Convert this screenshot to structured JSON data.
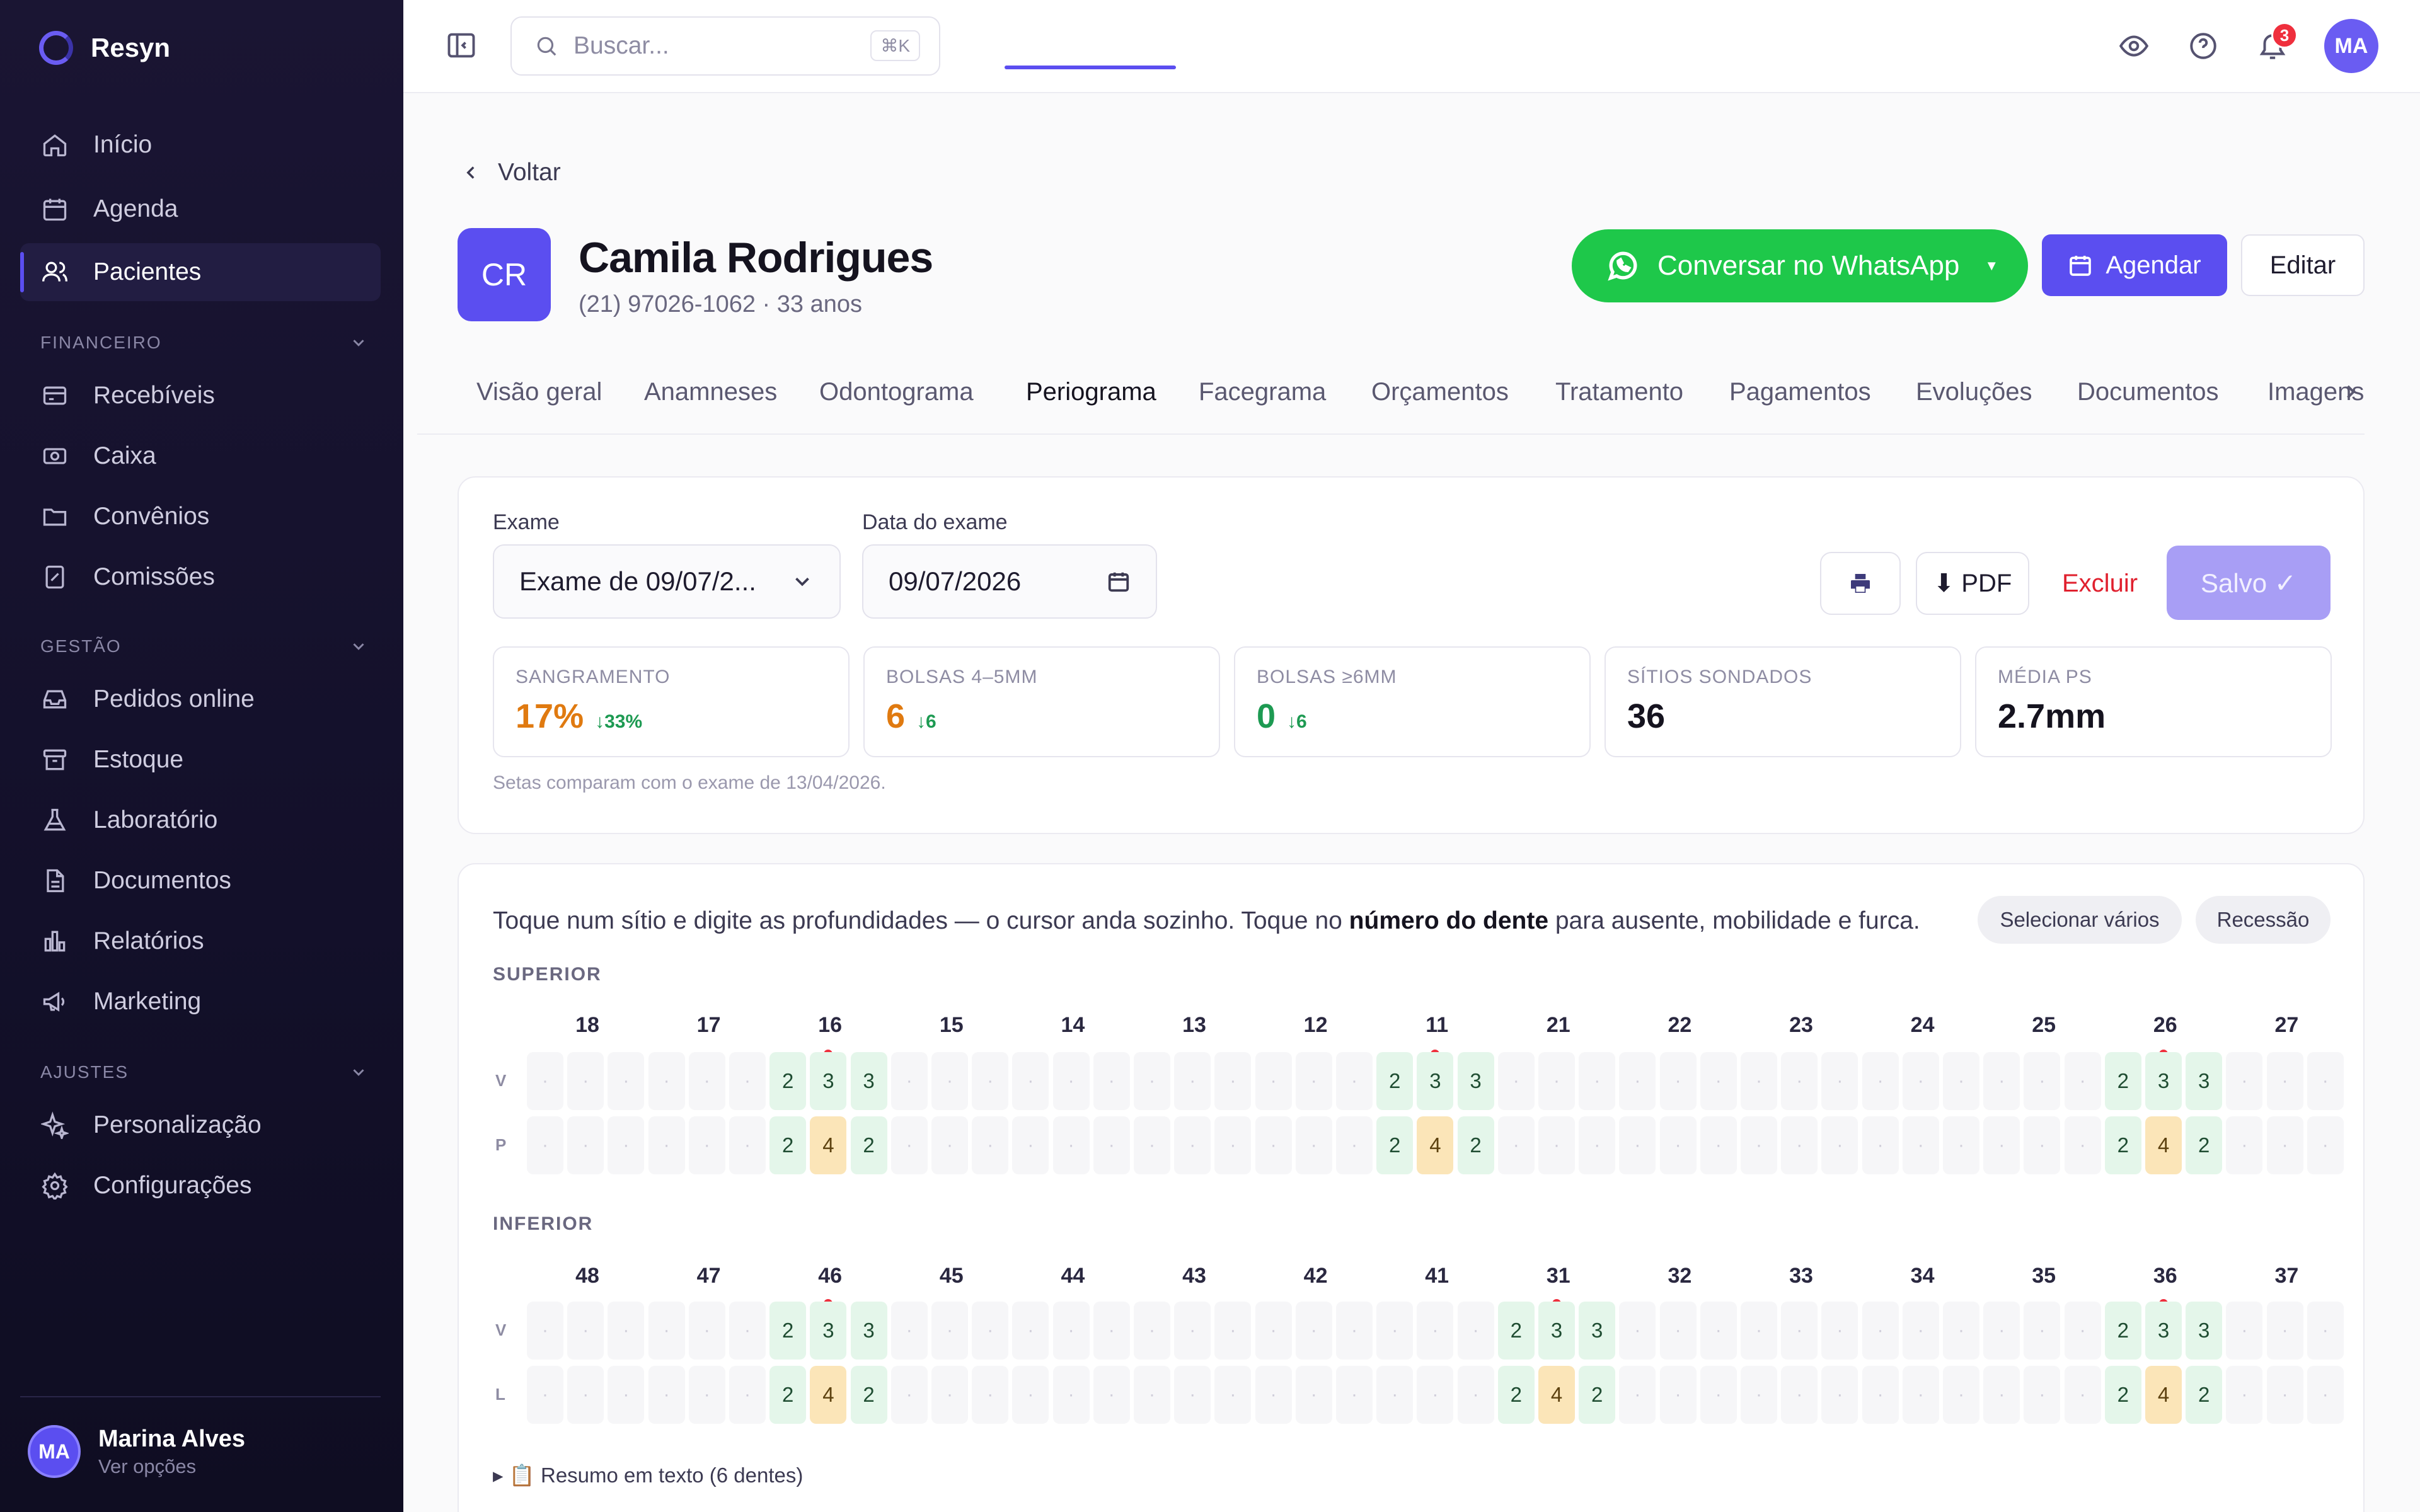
{
  "app": {
    "name": "Resyn",
    "accent": "#5b4ef0"
  },
  "sidebar": {
    "main_items": [
      {
        "label": "Início",
        "icon": "home-icon"
      },
      {
        "label": "Agenda",
        "icon": "calendar-icon"
      },
      {
        "label": "Pacientes",
        "icon": "users-icon",
        "active": true
      }
    ],
    "sections": [
      {
        "label": "FINANCEIRO",
        "items": [
          "Recebíveis",
          "Caixa",
          "Convênios",
          "Comissões"
        ]
      },
      {
        "label": "GESTÃO",
        "items": [
          "Pedidos online",
          "Estoque",
          "Laboratório",
          "Documentos",
          "Relatórios",
          "Marketing"
        ]
      },
      {
        "label": "AJUSTES",
        "items": [
          "Personalização",
          "Configurações"
        ]
      }
    ],
    "user": {
      "initials": "MA",
      "name": "Marina Alves",
      "subtitle": "Ver opções"
    }
  },
  "topbar": {
    "search_placeholder": "Buscar...",
    "search_shortcut": "⌘K",
    "notifications_count": "3",
    "avatar_initials": "MA"
  },
  "patient": {
    "back_label": "Voltar",
    "initials": "CR",
    "name": "Camila Rodrigues",
    "info": "(21) 97026-1062 · 33 anos",
    "whatsapp_label": "Conversar no WhatsApp",
    "schedule_label": "Agendar",
    "edit_label": "Editar"
  },
  "tabs": [
    {
      "label": "Visão geral"
    },
    {
      "label": "Anamneses"
    },
    {
      "label": "Odontograma"
    },
    {
      "label": "Periograma",
      "active": true
    },
    {
      "label": "Facegrama"
    },
    {
      "label": "Orçamentos"
    },
    {
      "label": "Tratamento"
    },
    {
      "label": "Pagamentos"
    },
    {
      "label": "Evoluções"
    },
    {
      "label": "Documentos"
    },
    {
      "label": "Imagens"
    }
  ],
  "exam": {
    "exam_label": "Exame",
    "exam_value": "Exame de 09/07/2...",
    "date_label": "Data do exame",
    "date_value": "09/07/2026",
    "pdf_label": "⬇ PDF",
    "delete_label": "Excluir",
    "saved_label": "Salvo ✓"
  },
  "stats": [
    {
      "label": "SANGRAMENTO",
      "value": "17%",
      "delta": "↓33%",
      "color": "#e07a10"
    },
    {
      "label": "BOLSAS 4–5MM",
      "value": "6",
      "delta": "↓6",
      "color": "#e07a10"
    },
    {
      "label": "BOLSAS ≥6MM",
      "value": "0",
      "delta": "↓6",
      "color": "#1d9a52"
    },
    {
      "label": "SÍTIOS SONDADOS",
      "value": "36",
      "delta": "",
      "color": "#15131f"
    },
    {
      "label": "MÉDIA PS",
      "value": "2.7mm",
      "delta": "",
      "color": "#15131f"
    }
  ],
  "stats_note": "Setas comparam com o exame de 13/04/2026.",
  "chart": {
    "instruction_pre": "Toque num sítio e digite as profundidades — o cursor anda sozinho. Toque no ",
    "instruction_bold": "número do dente",
    "instruction_post": " para ausente, mobilidade e furca.",
    "chip_multi": "Selecionar vários",
    "chip_recession": "Recessão",
    "upper": {
      "label": "SUPERIOR",
      "teeth": [
        "18",
        "17",
        "16",
        "15",
        "14",
        "13",
        "12",
        "11",
        "21",
        "22",
        "23",
        "24",
        "25",
        "26",
        "27"
      ],
      "rows": [
        {
          "label": "V",
          "filled": {
            "16": [
              "2",
              "3",
              "3"
            ],
            "11": [
              "2",
              "3",
              "3"
            ],
            "26": [
              "2",
              "3",
              "3"
            ]
          }
        },
        {
          "label": "P",
          "filled": {
            "16": [
              "2",
              "4",
              "2"
            ],
            "11": [
              "2",
              "4",
              "2"
            ],
            "26": [
              "2",
              "4",
              "2"
            ]
          }
        }
      ],
      "bleeding": [
        "16",
        "11",
        "26"
      ]
    },
    "lower": {
      "label": "INFERIOR",
      "teeth": [
        "48",
        "47",
        "46",
        "45",
        "44",
        "43",
        "42",
        "41",
        "31",
        "32",
        "33",
        "34",
        "35",
        "36",
        "37"
      ],
      "rows": [
        {
          "label": "V",
          "filled": {
            "46": [
              "2",
              "3",
              "3"
            ],
            "31": [
              "2",
              "3",
              "3"
            ],
            "36": [
              "2",
              "3",
              "3"
            ]
          }
        },
        {
          "label": "L",
          "filled": {
            "46": [
              "2",
              "4",
              "2"
            ],
            "31": [
              "2",
              "4",
              "2"
            ],
            "36": [
              "2",
              "4",
              "2"
            ]
          }
        }
      ],
      "bleeding": [
        "46",
        "31",
        "36"
      ]
    },
    "summary_label": "▸ 📋 Resumo em texto (6 dentes)"
  }
}
